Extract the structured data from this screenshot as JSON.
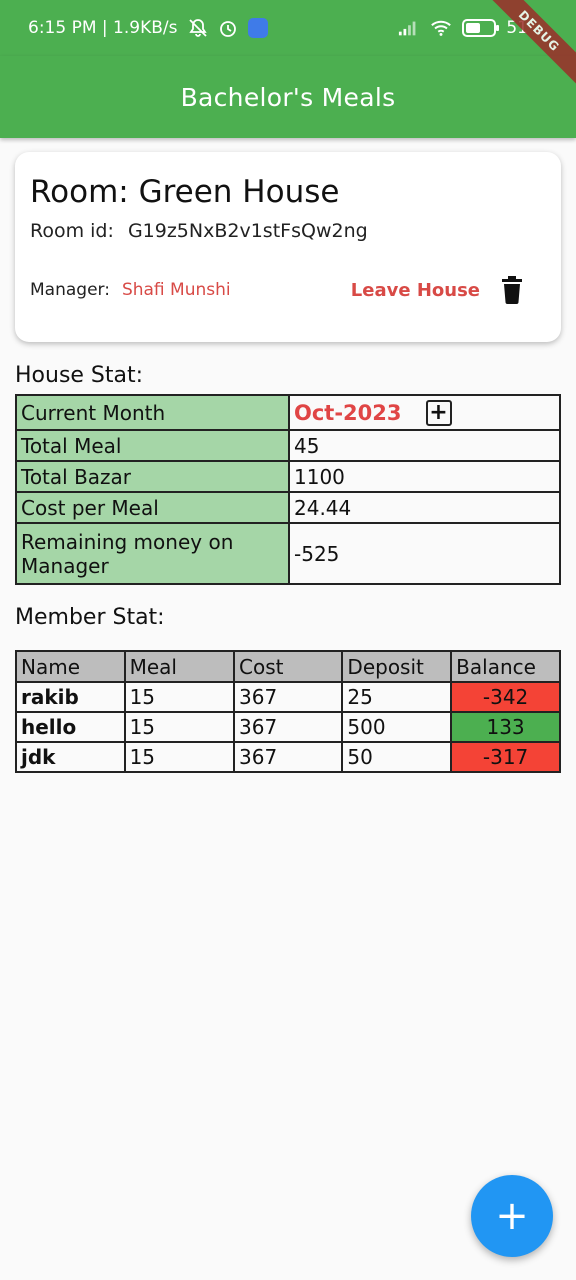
{
  "status_bar": {
    "time_speed": "6:15 PM | 1.9KB/s",
    "battery_text": "51"
  },
  "debug_label": "DEBUG",
  "app_bar": {
    "title": "Bachelor's Meals"
  },
  "room": {
    "title": "Room: Green House",
    "id_label": "Room id:",
    "id_value": "G19z5NxB2v1stFsQw2ng",
    "manager_label": "Manager:",
    "manager_name": "Shafi Munshi",
    "leave_label": "Leave House"
  },
  "house_stat": {
    "title": "House Stat:",
    "rows": [
      {
        "label": "Current Month",
        "value": "Oct-2023"
      },
      {
        "label": "Total Meal",
        "value": "45"
      },
      {
        "label": "Total Bazar",
        "value": "1100"
      },
      {
        "label": "Cost per Meal",
        "value": "24.44"
      },
      {
        "label": "Remaining money on Manager",
        "value": "-525"
      }
    ]
  },
  "member_stat": {
    "title": "Member Stat:",
    "headers": [
      "Name",
      "Meal",
      "Cost",
      "Deposit",
      "Balance"
    ],
    "rows": [
      {
        "name": "rakib",
        "meal": "15",
        "cost": "367",
        "deposit": "25",
        "balance": "-342"
      },
      {
        "name": "hello",
        "meal": "15",
        "cost": "367",
        "deposit": "500",
        "balance": "133"
      },
      {
        "name": "jdk",
        "meal": "15",
        "cost": "367",
        "deposit": "50",
        "balance": "-317"
      }
    ]
  },
  "fab_label": "+",
  "colors": {
    "primary_green": "#4caf50",
    "label_green": "#a5d6a7",
    "accent_red": "#d84a46",
    "negative": "#f44336",
    "fab_blue": "#2196f3"
  }
}
